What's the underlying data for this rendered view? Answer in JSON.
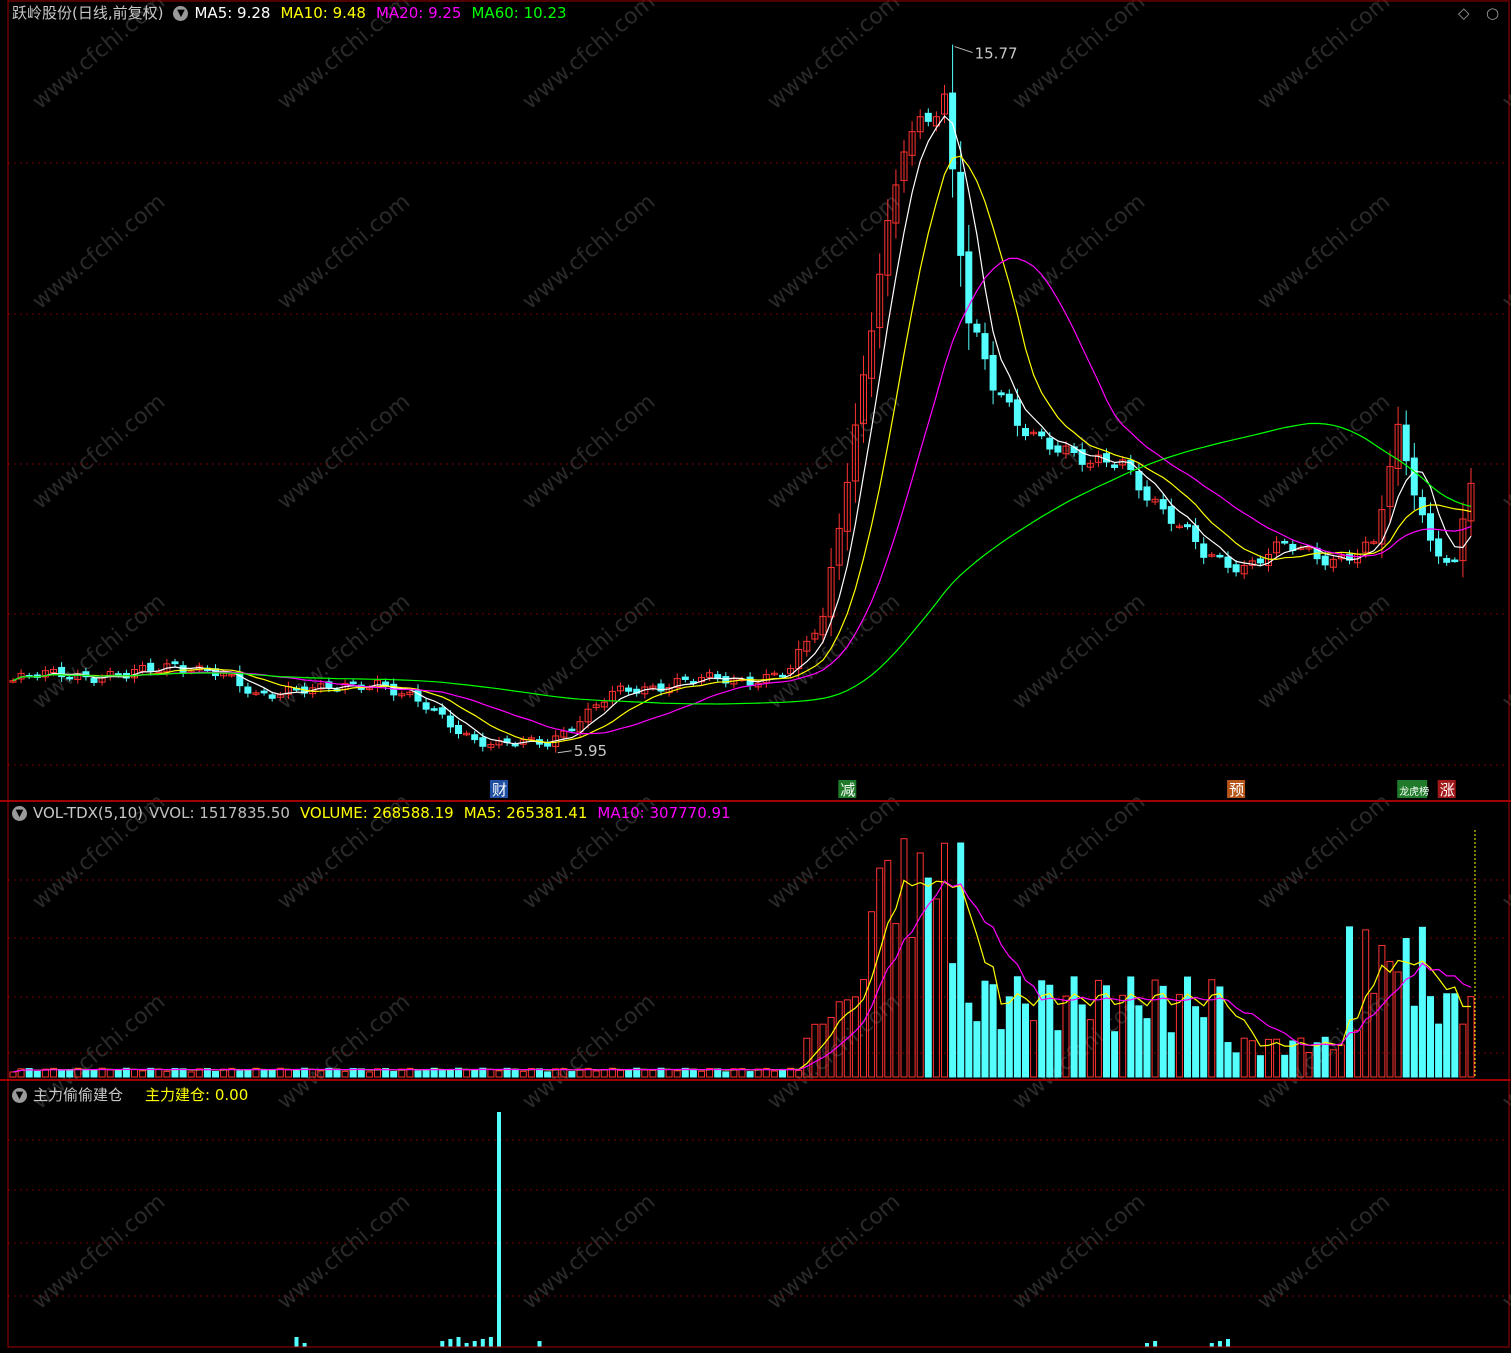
{
  "window": {
    "title": "跃岭股份(日线,前复权)",
    "icons": [
      "diamond-icon",
      "circle-icon"
    ]
  },
  "main_panel": {
    "indicators": [
      {
        "label": "MA5",
        "value": "9.28",
        "color": "#ffffff"
      },
      {
        "label": "MA10",
        "value": "9.48",
        "color": "#ffff00"
      },
      {
        "label": "MA20",
        "value": "9.25",
        "color": "#ff00ff"
      },
      {
        "label": "MA60",
        "value": "10.23",
        "color": "#00ff00"
      }
    ],
    "high_label": "15.77",
    "low_label": "5.95",
    "event_markers": [
      {
        "text": "财",
        "bg": "#1f4fa3"
      },
      {
        "text": "减",
        "bg": "#1f7a2a"
      },
      {
        "text": "预",
        "bg": "#b8561a"
      },
      {
        "text": "龙虎榜",
        "bg": "#1f7a2a"
      },
      {
        "text": "涨",
        "bg": "#a31818"
      }
    ]
  },
  "volume_panel": {
    "name": "VOL-TDX(5,10)",
    "indicators": [
      {
        "label": "VVOL",
        "value": "1517835.50",
        "color": "#c0c0c0"
      },
      {
        "label": "VOLUME",
        "value": "268588.19",
        "color": "#ffff00"
      },
      {
        "label": "MA5",
        "value": "265381.41",
        "color": "#ffff00"
      },
      {
        "label": "MA10",
        "value": "307770.91",
        "color": "#ff00ff"
      }
    ]
  },
  "signal_panel": {
    "name": "主力偷偷建仓",
    "indicators": [
      {
        "label": "主力建仓",
        "value": "0.00",
        "color": "#ffff00"
      }
    ]
  },
  "watermark": "www.cfchi.com",
  "colors": {
    "up": "#ff3232",
    "down": "#54ffff",
    "ma5": "#ffffff",
    "ma10": "#ffff00",
    "ma20": "#ff00ff",
    "ma60": "#00ff00",
    "grid": "#7a0000",
    "frame": "#a00000"
  },
  "chart_data": {
    "type": "candlestick",
    "keyframes": [
      {
        "i": 0,
        "c": 6.95
      },
      {
        "i": 6,
        "c": 7.05
      },
      {
        "i": 14,
        "c": 7.0
      },
      {
        "i": 20,
        "c": 7.2
      },
      {
        "i": 25,
        "c": 7.05
      },
      {
        "i": 30,
        "c": 6.75
      },
      {
        "i": 34,
        "c": 6.85
      },
      {
        "i": 38,
        "c": 6.8
      },
      {
        "i": 45,
        "c": 6.95
      },
      {
        "i": 52,
        "c": 6.5
      },
      {
        "i": 57,
        "c": 6.15
      },
      {
        "i": 60,
        "c": 6.05
      },
      {
        "i": 66,
        "c": 6.1
      },
      {
        "i": 74,
        "c": 6.75
      },
      {
        "i": 82,
        "c": 6.95
      },
      {
        "i": 90,
        "c": 6.95
      },
      {
        "i": 96,
        "c": 7.1
      },
      {
        "i": 100,
        "c": 7.8
      },
      {
        "i": 103,
        "c": 9.8
      },
      {
        "i": 107,
        "c": 12.6
      },
      {
        "i": 110,
        "c": 14.3
      },
      {
        "i": 115,
        "c": 15.1
      },
      {
        "i": 118,
        "c": 12.0
      },
      {
        "i": 121,
        "c": 11.0
      },
      {
        "i": 124,
        "c": 10.5
      },
      {
        "i": 128,
        "c": 10.3
      },
      {
        "i": 133,
        "c": 9.9
      },
      {
        "i": 137,
        "c": 10.0
      },
      {
        "i": 142,
        "c": 9.3
      },
      {
        "i": 147,
        "c": 8.7
      },
      {
        "i": 152,
        "c": 8.55
      },
      {
        "i": 157,
        "c": 8.8
      },
      {
        "i": 163,
        "c": 8.65
      },
      {
        "i": 168,
        "c": 8.8
      },
      {
        "i": 171,
        "c": 10.4
      },
      {
        "i": 175,
        "c": 8.9
      },
      {
        "i": 178,
        "c": 8.55
      },
      {
        "i": 180,
        "c": 9.7
      }
    ],
    "bars": 181,
    "high": 15.77,
    "low": 5.95,
    "ma60_last": 10.23
  }
}
